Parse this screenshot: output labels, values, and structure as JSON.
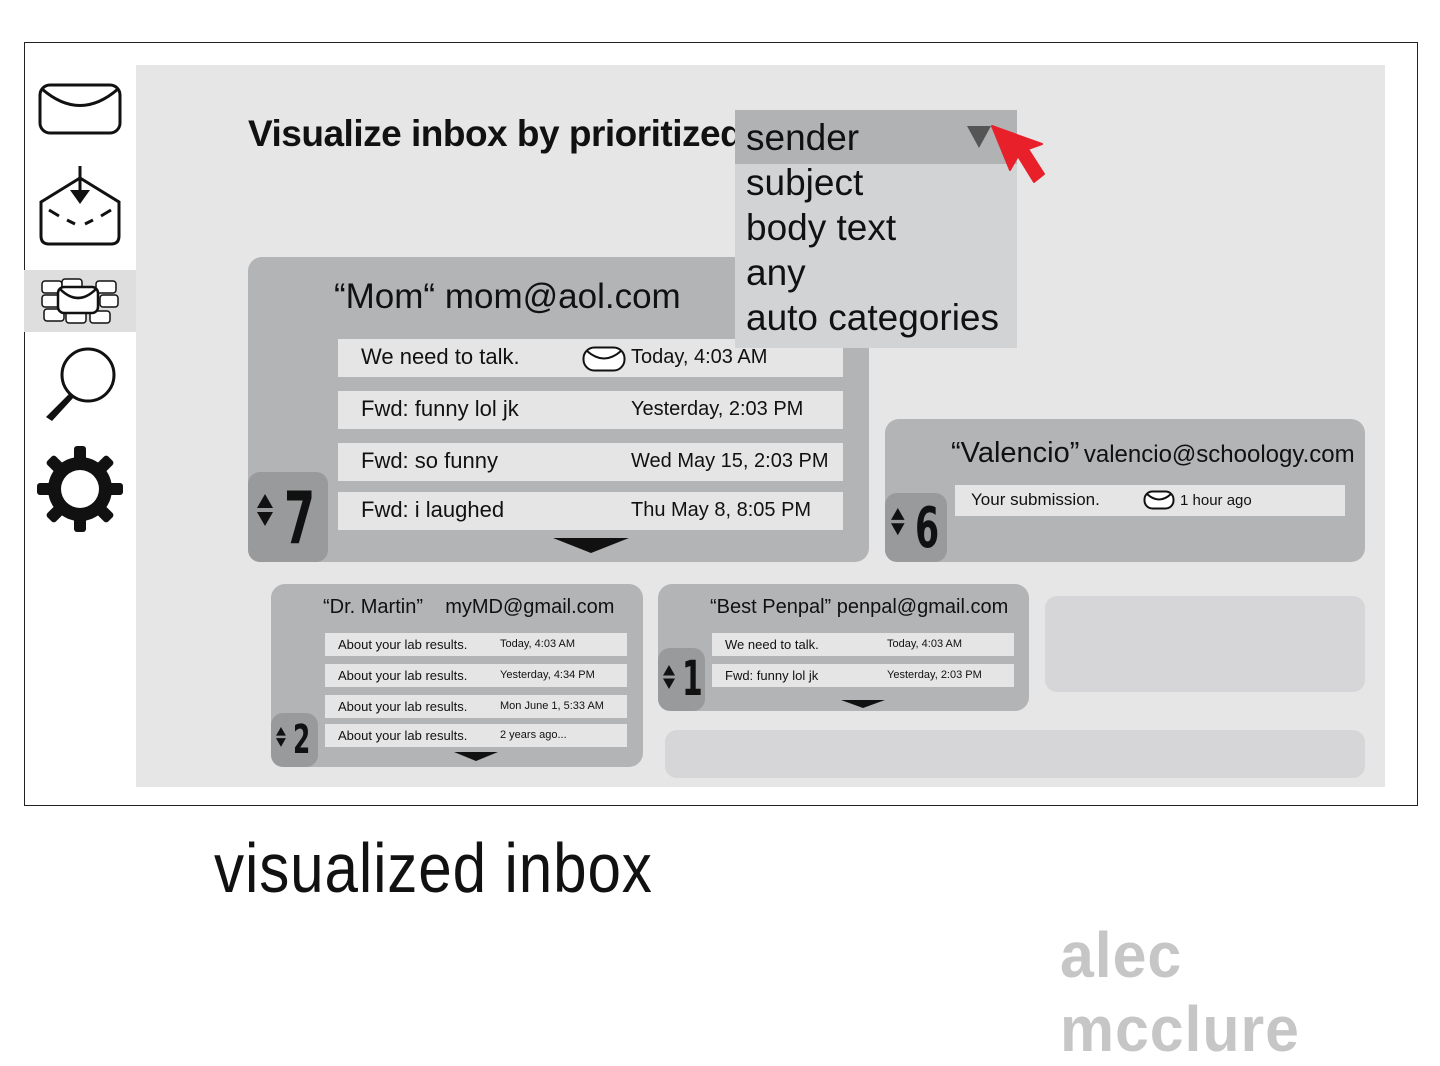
{
  "heading": "Visualize inbox by prioritized",
  "dropdown": {
    "selected": "sender",
    "options": [
      "subject",
      "body text",
      "any",
      "auto categories"
    ]
  },
  "cards": [
    {
      "rank": "7",
      "sender_name": "“Mom“",
      "sender_email": "mom@aol.com",
      "messages": [
        {
          "subject": "We need to talk.",
          "time": "Today, 4:03 AM",
          "unread_icon": "envelope-icon"
        },
        {
          "subject": "Fwd: funny lol jk",
          "time": "Yesterday, 2:03 PM"
        },
        {
          "subject": "Fwd: so funny",
          "time": "Wed May 15, 2:03 PM"
        },
        {
          "subject": "Fwd: i laughed",
          "time": "Thu May 8, 8:05 PM"
        }
      ]
    },
    {
      "rank": "6",
      "sender_name": "“Valencio”",
      "sender_email": "valencio@schoology.com",
      "messages": [
        {
          "subject": "Your submission.",
          "time": "1 hour ago",
          "unread_icon": "envelope-icon"
        }
      ]
    },
    {
      "rank": "2",
      "sender_name": "“Dr. Martin”",
      "sender_email": "myMD@gmail.com",
      "messages": [
        {
          "subject": "About your lab results.",
          "time": "Today, 4:03 AM"
        },
        {
          "subject": "About your lab results.",
          "time": "Yesterday, 4:34 PM"
        },
        {
          "subject": "About your lab results.",
          "time": "Mon June 1, 5:33 AM"
        },
        {
          "subject": "About your lab results.",
          "time": "2 years ago..."
        }
      ]
    },
    {
      "rank": "1",
      "sender_name": "“Best Penpal”",
      "sender_email": "penpal@gmail.com",
      "messages": [
        {
          "subject": "We need to talk.",
          "time": "Today, 4:03 AM"
        },
        {
          "subject": "Fwd: funny lol jk",
          "time": "Yesterday, 2:03 PM"
        }
      ]
    }
  ],
  "sidebar": [
    "mail-icon",
    "inbox-download-icon",
    "visualized-inbox-icon",
    "search-icon",
    "settings-gear-icon"
  ],
  "caption": "visualized inbox",
  "author": "alec mcclure"
}
